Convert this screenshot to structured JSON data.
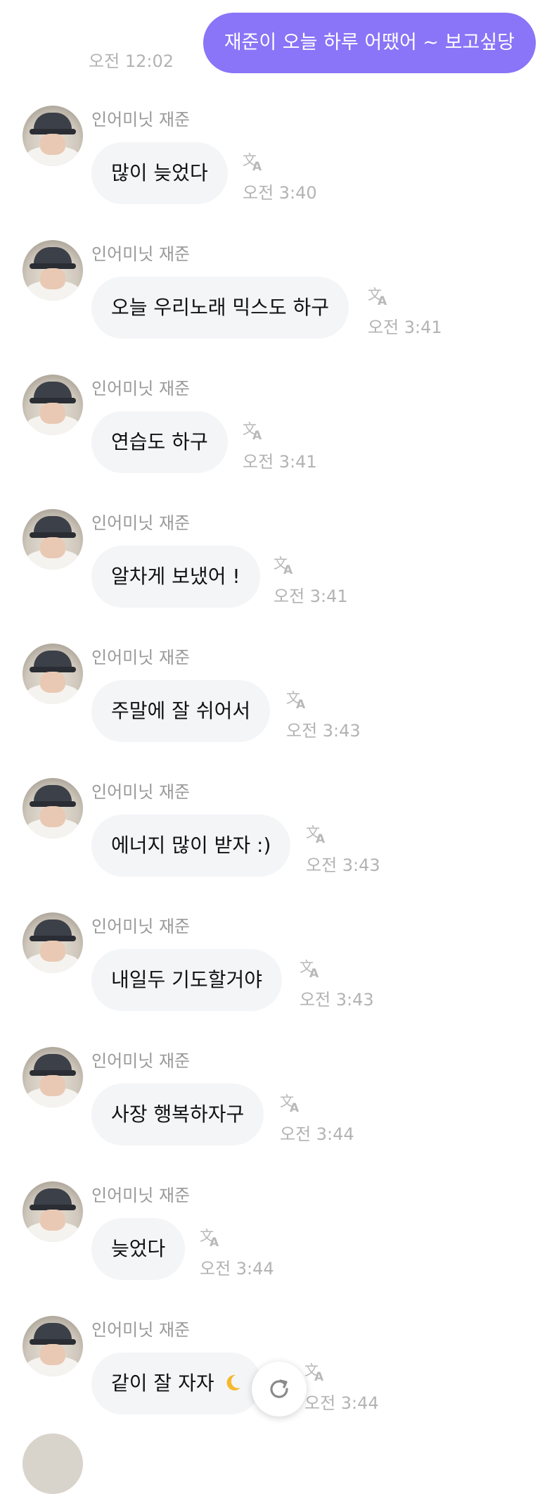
{
  "outgoing": {
    "text": "재준이 오늘 하루 어땠어 ~  보고싶당",
    "time": "오전 12:02"
  },
  "sender_name": "인어미닛 재준",
  "messages": [
    {
      "text": "많이 늦었다",
      "time": "오전 3:40"
    },
    {
      "text": "오늘 우리노래 믹스도 하구",
      "time": "오전 3:41"
    },
    {
      "text": "연습도 하구",
      "time": "오전 3:41"
    },
    {
      "text": "알차게 보냈어 !",
      "time": "오전 3:41"
    },
    {
      "text": "주말에 잘 쉬어서",
      "time": "오전 3:43"
    },
    {
      "text": "에너지 많이 받자 :)",
      "time": "오전 3:43"
    },
    {
      "text": "내일두 기도할거야",
      "time": "오전 3:43"
    },
    {
      "text": "사장 행복하자구",
      "time": "오전 3:44"
    },
    {
      "text": "늦었다",
      "time": "오전 3:44"
    },
    {
      "text": "같이 잘 자자",
      "time": "오전 3:44",
      "emoji": "crescent-moon-icon"
    }
  ],
  "icons": {
    "translate": "translate-icon",
    "refresh": "refresh-icon",
    "avatar": "avatar"
  },
  "colors": {
    "outgoing_bubble": "#8a74f7",
    "incoming_bubble": "#f4f5f7",
    "meta_text": "#b3b3b3"
  }
}
